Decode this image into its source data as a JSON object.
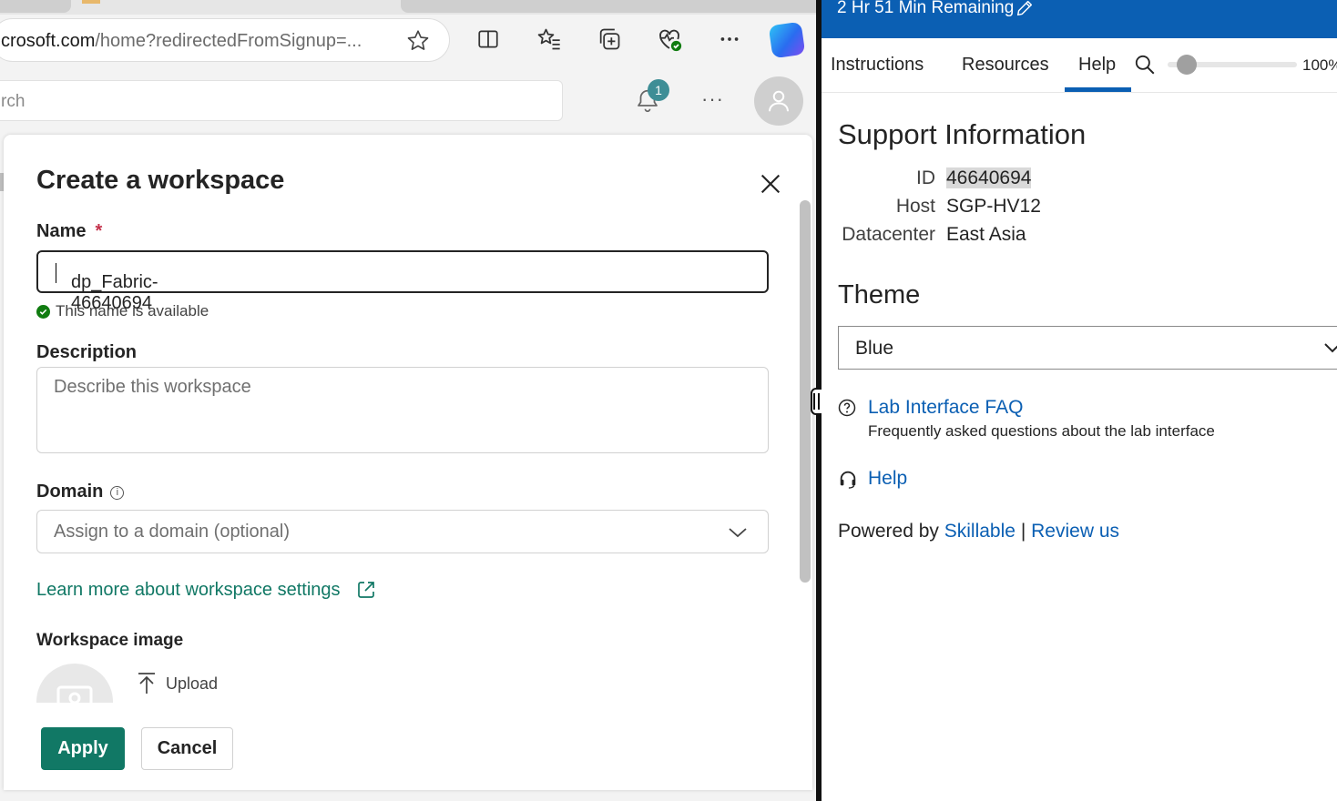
{
  "browser": {
    "url_host": "crosoft.com",
    "url_rest": "/home?redirectedFromSignup=..."
  },
  "appbar": {
    "search_placeholder": "rch",
    "notification_count": "1",
    "more_label": "···"
  },
  "dialog": {
    "title": "Create a workspace",
    "name_label": "Name",
    "required_mark": "*",
    "name_value": "dp_Fabric-46640694",
    "availability": "This name is available",
    "description_label": "Description",
    "description_placeholder": "Describe this workspace",
    "domain_label": "Domain",
    "domain_info": "i",
    "domain_placeholder": "Assign to a domain (optional)",
    "learn_more": "Learn more about workspace settings",
    "workspace_image_label": "Workspace image",
    "upload_label": "Upload",
    "apply_label": "Apply",
    "cancel_label": "Cancel"
  },
  "lab": {
    "time_remaining": "2 Hr 51 Min Remaining",
    "tabs": [
      "Instructions",
      "Resources",
      "Help"
    ],
    "active_tab": "Help",
    "zoom": "100%",
    "support_heading": "Support Information",
    "support": [
      {
        "key": "ID",
        "value": "46640694"
      },
      {
        "key": "Host",
        "value": "SGP-HV12"
      },
      {
        "key": "Datacenter",
        "value": "East Asia"
      }
    ],
    "theme_heading": "Theme",
    "theme_value": "Blue",
    "faq_link": "Lab Interface FAQ",
    "faq_desc": "Frequently asked questions about the lab interface",
    "help_link": "Help",
    "powered_by": "Powered by",
    "skillable": "Skillable",
    "separator": "|",
    "review_us": "Review us",
    "colors": {
      "header": "#0b5fb3",
      "link": "#0b5fb3",
      "fabric_green": "#117865"
    }
  }
}
